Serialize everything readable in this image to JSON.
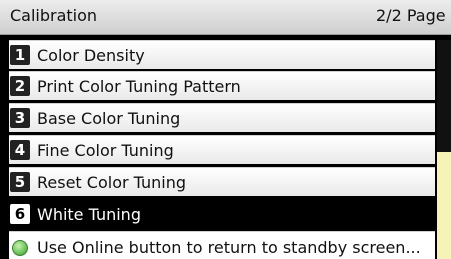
{
  "header": {
    "title": "Calibration",
    "page_indicator": "2/2 Page"
  },
  "menu": {
    "items": [
      {
        "number": "1",
        "label": "Color Density"
      },
      {
        "number": "2",
        "label": "Print Color Tuning Pattern"
      },
      {
        "number": "3",
        "label": "Base Color Tuning"
      },
      {
        "number": "4",
        "label": "Fine Color Tuning"
      },
      {
        "number": "5",
        "label": "Reset Color Tuning"
      },
      {
        "number": "6",
        "label": "White Tuning"
      }
    ],
    "selected_index": 5
  },
  "status": {
    "message": "Use Online button to return to standby screen...",
    "indicator_icon": "online-indicator-icon"
  },
  "colors": {
    "header_bg": "#dcdcdc",
    "selected_bg": "#000000",
    "scroll_thumb": "#f6f3b8",
    "indicator_green": "#6bc15a"
  }
}
